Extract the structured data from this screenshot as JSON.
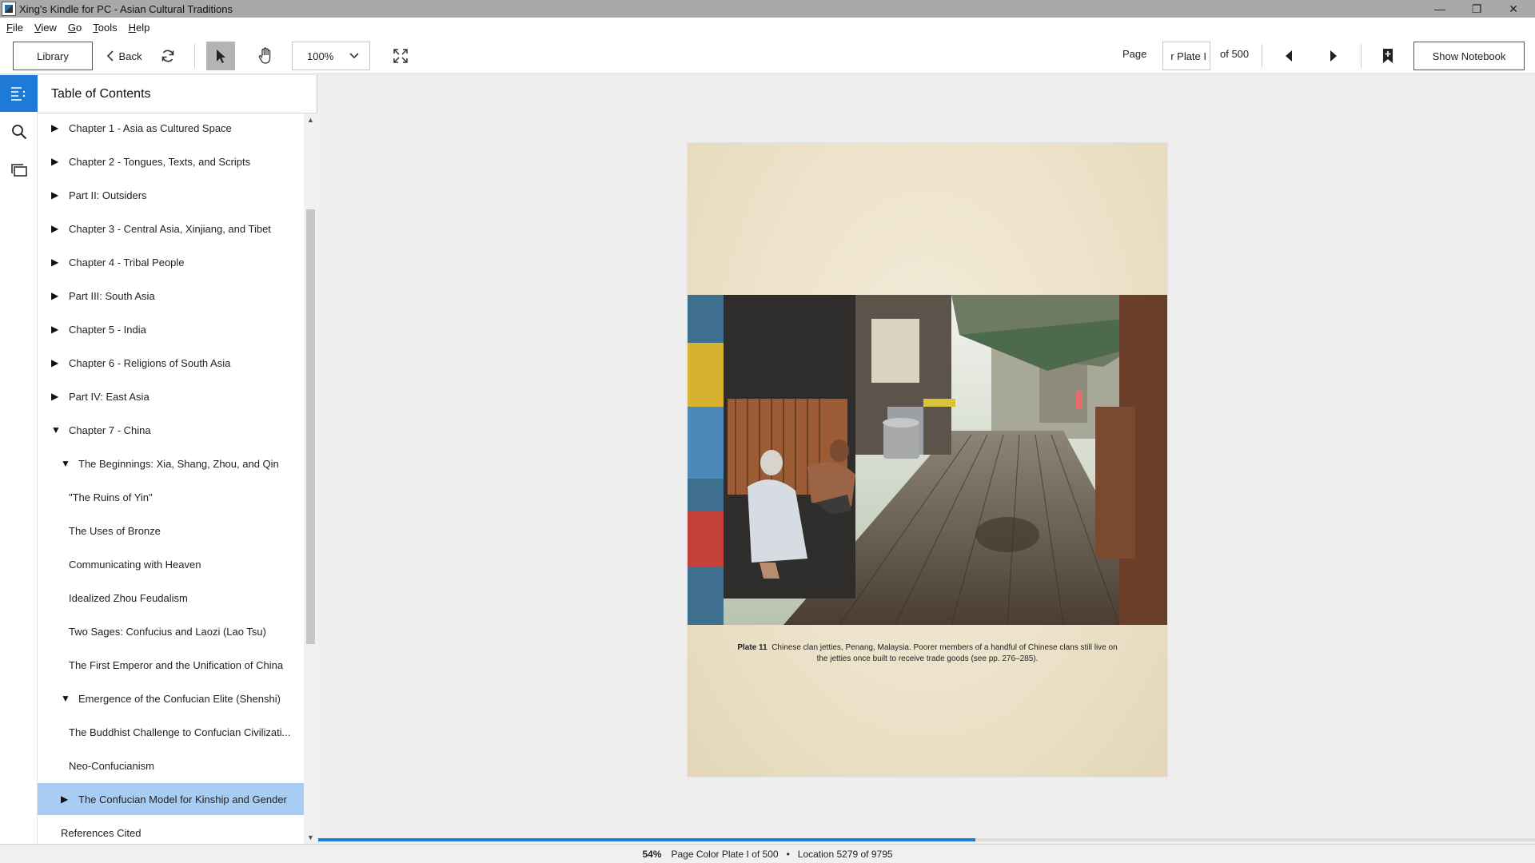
{
  "window": {
    "title": "Xing's Kindle for PC - Asian Cultural Traditions",
    "controls": [
      "minimize-icon",
      "restore-icon",
      "close-icon"
    ]
  },
  "menu": [
    "File",
    "View",
    "Go",
    "Tools",
    "Help"
  ],
  "toolbar": {
    "library_label": "Library",
    "back_label": "Back",
    "zoom_value": "100%",
    "page_label": "Page",
    "page_value": "r Plate I",
    "page_of": "of 500",
    "notebook_label": "Show Notebook"
  },
  "toc": {
    "title": "Table of Contents",
    "items": [
      {
        "label": "Chapter 1 - Asia as Cultured Space",
        "arrow": "▶",
        "indent": 0
      },
      {
        "label": "Chapter 2 - Tongues, Texts, and Scripts",
        "arrow": "▶",
        "indent": 0
      },
      {
        "label": "Part II: Outsiders",
        "arrow": "▶",
        "indent": 0
      },
      {
        "label": "Chapter 3 - Central Asia, Xinjiang, and Tibet",
        "arrow": "▶",
        "indent": 0
      },
      {
        "label": "Chapter 4 - Tribal People",
        "arrow": "▶",
        "indent": 0
      },
      {
        "label": "Part III: South Asia",
        "arrow": "▶",
        "indent": 0
      },
      {
        "label": "Chapter 5 - India",
        "arrow": "▶",
        "indent": 0
      },
      {
        "label": "Chapter 6 - Religions of South Asia",
        "arrow": "▶",
        "indent": 0
      },
      {
        "label": "Part IV: East Asia",
        "arrow": "▶",
        "indent": 0
      },
      {
        "label": "Chapter 7 - China",
        "arrow": "▼",
        "indent": 0
      },
      {
        "label": "The Beginnings: Xia, Shang, Zhou, and Qin",
        "arrow": "▼",
        "indent": 1
      },
      {
        "label": "\"The Ruins of Yin\"",
        "arrow": "",
        "indent": 2
      },
      {
        "label": "The Uses of Bronze",
        "arrow": "",
        "indent": 2
      },
      {
        "label": "Communicating with Heaven",
        "arrow": "",
        "indent": 2
      },
      {
        "label": "Idealized Zhou Feudalism",
        "arrow": "",
        "indent": 2
      },
      {
        "label": "Two Sages: Confucius and Laozi (Lao Tsu)",
        "arrow": "",
        "indent": 2
      },
      {
        "label": "The First Emperor and the Unification of China",
        "arrow": "",
        "indent": 2
      },
      {
        "label": "Emergence of the Confucian Elite (Shenshi)",
        "arrow": "▼",
        "indent": 1
      },
      {
        "label": "The Buddhist Challenge to Confucian Civilizati...",
        "arrow": "",
        "indent": 2
      },
      {
        "label": "Neo-Confucianism",
        "arrow": "",
        "indent": 2
      },
      {
        "label": "The Confucian Model for Kinship and Gender",
        "arrow": "▶",
        "indent": 1,
        "selected": true
      },
      {
        "label": "References Cited",
        "arrow": "",
        "indent": 3
      }
    ]
  },
  "book_page": {
    "caption_label": "Plate 11",
    "caption_text": "Chinese clan jetties, Penang, Malaysia. Poorer members of a handful of Chinese clans still live on the jetties once built to receive trade goods (see pp. 276–285)."
  },
  "status": {
    "percent": "54%",
    "progress_fraction": 0.54,
    "page_info": "Page Color Plate I of 500",
    "location": "Location 5279 of 9795"
  },
  "colors": {
    "accent": "#1d7ad6",
    "selected_row": "#a8cdf5",
    "titlebar": "#a9a9a9"
  }
}
